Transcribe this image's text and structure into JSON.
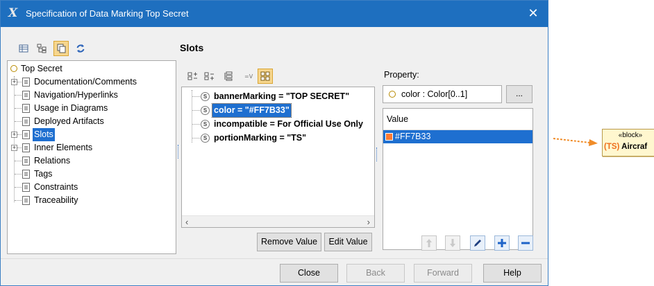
{
  "window": {
    "title": "Specification of Data Marking Top Secret",
    "close_glyph": "✕"
  },
  "section_title": "Slots",
  "tree": {
    "items": [
      {
        "label": "Top Secret",
        "icon": "instance-icon"
      },
      {
        "label": "Documentation/Comments",
        "expandable": true
      },
      {
        "label": "Navigation/Hyperlinks"
      },
      {
        "label": "Usage in Diagrams"
      },
      {
        "label": "Deployed Artifacts"
      },
      {
        "label": "Slots",
        "expandable": true,
        "selected": true
      },
      {
        "label": "Inner Elements",
        "expandable": true
      },
      {
        "label": "Relations"
      },
      {
        "label": "Tags"
      },
      {
        "label": "Constraints"
      },
      {
        "label": "Traceability"
      }
    ]
  },
  "slots": {
    "items": [
      {
        "label": "bannerMarking = \"TOP SECRET\""
      },
      {
        "label": "color = \"#FF7B33\"",
        "selected": true
      },
      {
        "label": "incompatible = For Official Use Only"
      },
      {
        "label": "portionMarking = \"TS\""
      }
    ],
    "remove_value_label": "Remove Value",
    "edit_value_label": "Edit Value"
  },
  "property": {
    "label": "Property:",
    "value": "color : Color[0..1]",
    "browse_label": "..."
  },
  "values": {
    "header": "Value",
    "rows": [
      {
        "label": "#FF7B33",
        "color": "#FF7B33"
      }
    ]
  },
  "footer": {
    "close_label": "Close",
    "back_label": "Back",
    "forward_label": "Forward",
    "help_label": "Help"
  },
  "diagram": {
    "stereotype": "«block»",
    "prefix": "(TS)",
    "name": "Aircraf",
    "arrow_color": "#F08C28"
  },
  "colors": {
    "title_bar": "#1E6FBF",
    "selection": "#1E6FD0",
    "active_toggle": "#F6D68E"
  }
}
